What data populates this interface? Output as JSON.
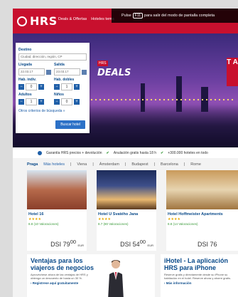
{
  "brand": {
    "name": "HRS"
  },
  "nav": {
    "item1": "Deals & Offertas",
    "item2": "Hoteles tema"
  },
  "fullscreen": {
    "prefix": "Pulse",
    "key": "F11",
    "suffix": "para salir del modo de pantalla completa"
  },
  "search": {
    "destination_label": "Destino",
    "destination_value": "Ciudad, dirección, región, CP",
    "checkin_label": "Llegada",
    "checkin_value": "22.03.17",
    "checkout_label": "Salida",
    "checkout_value": "23.03.17",
    "rooms1_label": "Hab. indiv.",
    "rooms1_value": "0",
    "rooms2_label": "Hab. dobles",
    "rooms2_value": "1",
    "adults_label": "Adultos",
    "adults_value": "1",
    "children_label": "Niños",
    "children_value": "0",
    "more_label": "Otros criterios de búsqueda »",
    "submit_label": "Buscar hotel"
  },
  "promo": {
    "deals_top": "HRS",
    "deals_main": "DEALS",
    "side_text": "T A"
  },
  "guarantee": {
    "item1": "Garantía HRS precios + devolución",
    "item2": "Anulación gratis hasta 18 h",
    "item3": "+300.000 hoteles en todo"
  },
  "tabs": {
    "active": "Praga",
    "sub": "Más hoteles",
    "items": [
      "Viena",
      "Ámsterdam",
      "Budapest",
      "Barcelona",
      "Rome"
    ]
  },
  "hotels": [
    {
      "name": "Hotel 16",
      "stars": "★★★★",
      "rating": "8.8 (10 Valoraciones)",
      "price": "DSI 79",
      "price_dec": "00",
      "currency": "EUR"
    },
    {
      "name": "Hotel U Svatého Jana",
      "stars": "★★★★",
      "rating": "8.7 (80 Valoraciones)",
      "price": "DSI 54",
      "price_dec": "00",
      "currency": "EUR"
    },
    {
      "name": "Hotel Hoffmeister Apartments",
      "stars": "★★★★",
      "rating": "8.8 (14 Valoraciones)",
      "price": "DSI 76",
      "price_dec": "",
      "currency": ""
    }
  ],
  "panels": {
    "left_title": "Ventajas para los viajeros de negocios",
    "left_text": "Aprovéchese ahora de las ventajas de HRS y obtenga un descuento de hasta un 30 %.",
    "left_link": "Registrese aquí gratuitamente",
    "right_title": "iHotel - La aplicación HRS para iPhone",
    "right_text": "Reserve gratis y directamente desde su iPhone su habitación en el hotel. Reserve ahora y ahorre gratis.",
    "right_link": "Más información"
  },
  "colors": {
    "brand_red": "#c8102e",
    "link_blue": "#0b4b8a",
    "button_blue": "#2c71c7"
  }
}
